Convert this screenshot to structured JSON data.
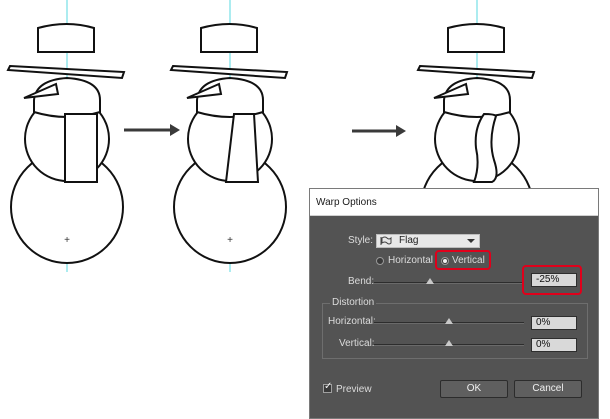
{
  "dialog": {
    "title": "Warp Options",
    "style_label": "Style:",
    "style_value": "Flag",
    "style_icon": "flag-icon",
    "orientation": {
      "horizontal_label": "Horizontal",
      "vertical_label": "Vertical",
      "selected": "Vertical"
    },
    "bend_label": "Bend:",
    "bend_value": "-25%",
    "bend_percent": -25,
    "distortion_group_label": "Distortion",
    "distortion": {
      "horizontal_label": "Horizontal:",
      "horizontal_value": "0%",
      "horizontal_percent": 0,
      "vertical_label": "Vertical:",
      "vertical_value": "0%",
      "vertical_percent": 0
    },
    "preview_label": "Preview",
    "preview_checked": true,
    "ok_label": "OK",
    "cancel_label": "Cancel"
  },
  "colors": {
    "dialog_bg": "#535353",
    "highlight": "#e0001b",
    "guide": "#58d8e0",
    "arrow": "#3a3a3a"
  }
}
